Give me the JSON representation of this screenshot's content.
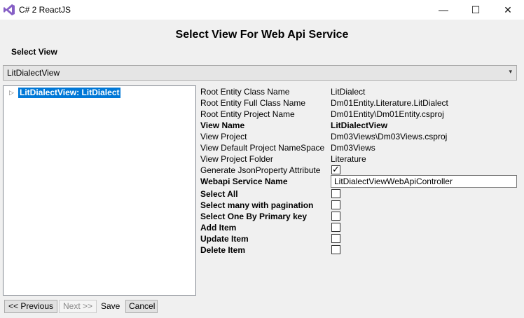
{
  "window": {
    "title": "C# 2 ReactJS",
    "minimize": "—",
    "maximize": "☐",
    "close": "✕"
  },
  "heading": "Select View For Web Api Service",
  "select_view_label": "Select View",
  "combo": {
    "value": "LitDialectView",
    "arrow": "▾"
  },
  "tree": {
    "expander": "▷",
    "node": "LitDialectView: LitDialect"
  },
  "properties": [
    {
      "label": "Root Entity Class Name",
      "value": "LitDialect"
    },
    {
      "label": "Root Entity Full Class Name",
      "value": "Dm01Entity.Literature.LitDialect"
    },
    {
      "label": "Root Entity Project Name",
      "value": "Dm01Entity\\Dm01Entity.csproj"
    },
    {
      "label": "View Name",
      "value": "LitDialectView"
    },
    {
      "label": "View Project",
      "value": "Dm03Views\\Dm03Views.csproj"
    },
    {
      "label": "View Default Project NameSpace",
      "value": "Dm03Views"
    },
    {
      "label": "View Project Folder",
      "value": "Literature"
    },
    {
      "label": "Generate JsonProperty Attribute",
      "checked": true
    },
    {
      "label": "Webapi Service Name",
      "value": "LitDialectViewWebApiController"
    },
    {
      "label": "Select All",
      "checked": false
    },
    {
      "label": "Select many with pagination",
      "checked": false
    },
    {
      "label": "Select One By Primary key",
      "checked": false
    },
    {
      "label": "Add Item",
      "checked": false
    },
    {
      "label": "Update Item",
      "checked": false
    },
    {
      "label": "Delete Item",
      "checked": false
    }
  ],
  "check_mark": "✓",
  "buttons": {
    "prev": "<< Previous",
    "next": "Next >>",
    "save": "Save",
    "cancel": "Cancel"
  },
  "colors": {
    "selection": "#0078d7",
    "app_icon": "#865fc5"
  }
}
